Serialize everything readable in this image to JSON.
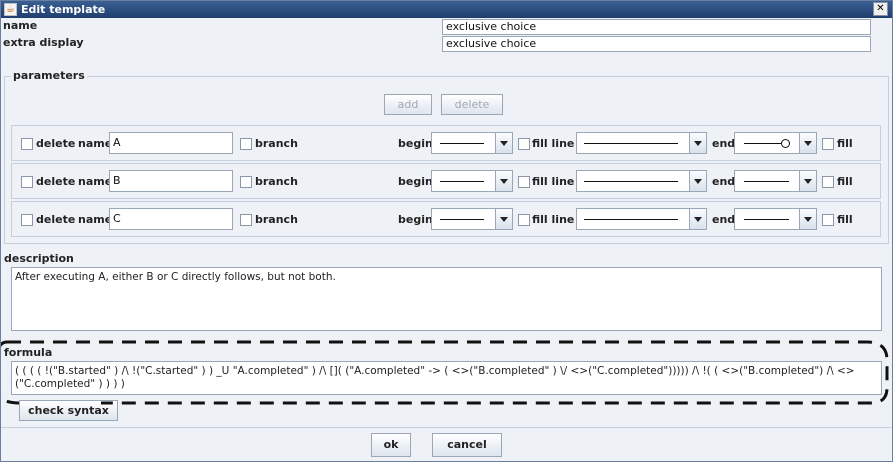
{
  "window": {
    "title": "Edit template"
  },
  "fields": {
    "name_label": "name",
    "name_value": "exclusive choice",
    "extra_label": "extra display",
    "extra_value": "exclusive choice"
  },
  "parameters": {
    "title": "parameters",
    "add_label": "add",
    "delete_label": "delete",
    "rows": [
      {
        "delete_label": "delete",
        "name_label": "name",
        "name_value": "A",
        "branch_label": "branch",
        "begin_label": "begin",
        "fill_line_label": "fill line",
        "end_label": "end",
        "fill_label": "fill",
        "end_style": "line-circle"
      },
      {
        "delete_label": "delete",
        "name_label": "name",
        "name_value": "B",
        "branch_label": "branch",
        "begin_label": "begin",
        "fill_line_label": "fill line",
        "end_label": "end",
        "fill_label": "fill",
        "end_style": "line"
      },
      {
        "delete_label": "delete",
        "name_label": "name",
        "name_value": "C",
        "branch_label": "branch",
        "begin_label": "begin",
        "fill_line_label": "fill line",
        "end_label": "end",
        "fill_label": "fill",
        "end_style": "line"
      }
    ]
  },
  "description": {
    "title": "description",
    "text": "After executing A, either B or C directly follows, but not both."
  },
  "formula": {
    "title": "formula",
    "text": "( ( ( ( !(\"B.started\" ) /\\ !(\"C.started\" ) )  _U \"A.completed\" ) /\\ []( (\"A.completed\" -> ( <>(\"B.completed\" ) \\/ <>(\"C.completed\"))))) /\\ !( ( <>(\"B.completed\") /\\ <>(\"C.completed\" ) ) ) )",
    "check_label": "check syntax"
  },
  "footer": {
    "ok_label": "ok",
    "cancel_label": "cancel"
  }
}
